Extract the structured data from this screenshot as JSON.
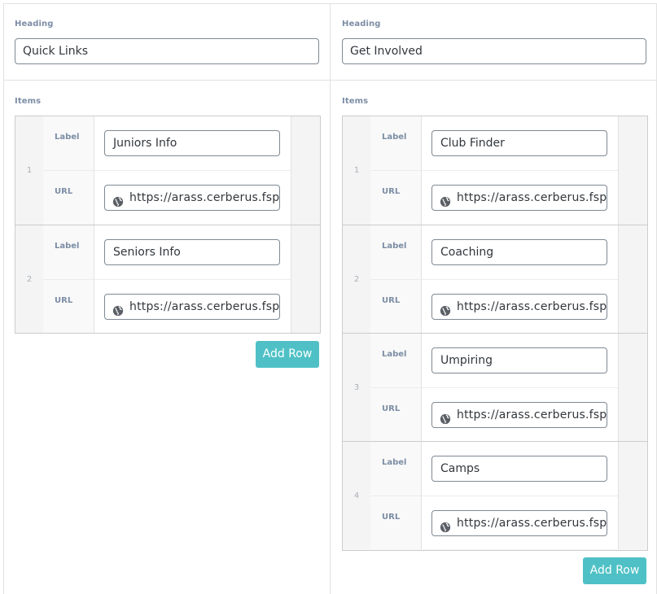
{
  "left": {
    "heading_label": "Heading",
    "heading_value": "Quick Links",
    "items_label": "Items",
    "rows": [
      {
        "num": "1",
        "label_field": "Label",
        "label_value": "Juniors Info",
        "url_field": "URL",
        "url_value": "https://arass.cerberus.fsp"
      },
      {
        "num": "2",
        "label_field": "Label",
        "label_value": "Seniors Info",
        "url_field": "URL",
        "url_value": "https://arass.cerberus.fsp"
      }
    ],
    "add_row": "Add Row"
  },
  "right": {
    "heading_label": "Heading",
    "heading_value": "Get Involved",
    "items_label": "Items",
    "rows": [
      {
        "num": "1",
        "label_field": "Label",
        "label_value": "Club Finder",
        "url_field": "URL",
        "url_value": "https://arass.cerberus.fsp"
      },
      {
        "num": "2",
        "label_field": "Label",
        "label_value": "Coaching",
        "url_field": "URL",
        "url_value": "https://arass.cerberus.fsp"
      },
      {
        "num": "3",
        "label_field": "Label",
        "label_value": "Umpiring",
        "url_field": "URL",
        "url_value": "https://arass.cerberus.fsp"
      },
      {
        "num": "4",
        "label_field": "Label",
        "label_value": "Camps",
        "url_field": "URL",
        "url_value": "https://arass.cerberus.fsp"
      }
    ],
    "add_row": "Add Row"
  },
  "colors": {
    "accent": "#4fc1c6",
    "label": "#7c8da5",
    "border": "#cccccc"
  },
  "icons": {
    "url_prefix": "globe-icon"
  }
}
